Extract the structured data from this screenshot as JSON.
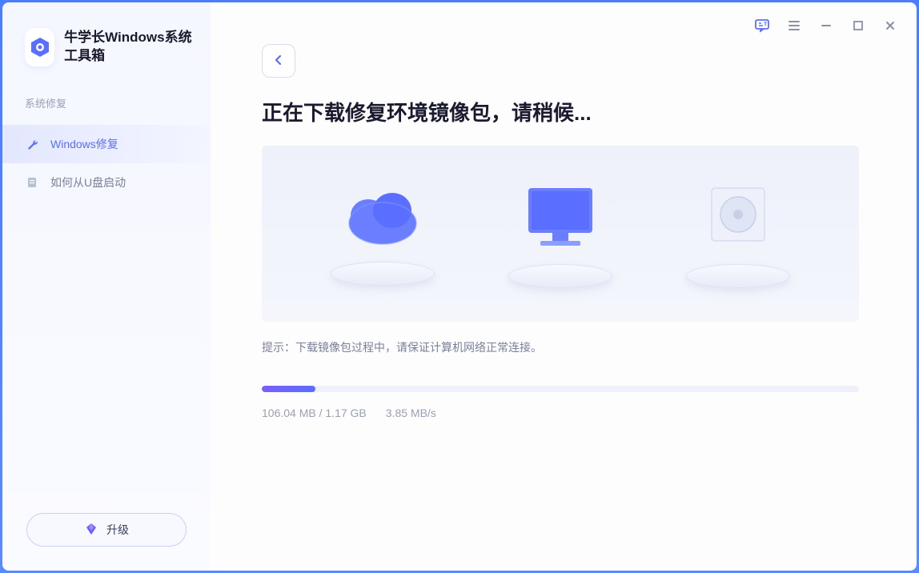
{
  "app": {
    "title": "牛学长Windows系统工具箱"
  },
  "sidebar": {
    "section_label": "系统修复",
    "items": [
      {
        "label": "Windows修复",
        "icon": "wrench-icon",
        "active": true
      },
      {
        "label": "如何从U盘启动",
        "icon": "document-icon",
        "active": false
      }
    ],
    "upgrade_label": "升级"
  },
  "main": {
    "title": "正在下载修复环境镜像包，请稍候...",
    "hint_prefix": "提示：",
    "hint_text": "下载镜像包过程中，请保证计算机网络正常连接。",
    "progress": {
      "downloaded": "106.04 MB",
      "total": "1.17 GB",
      "speed": "3.85 MB/s",
      "percent": 9
    }
  },
  "colors": {
    "accent": "#5a6eff",
    "accent2": "#7a5eff"
  }
}
